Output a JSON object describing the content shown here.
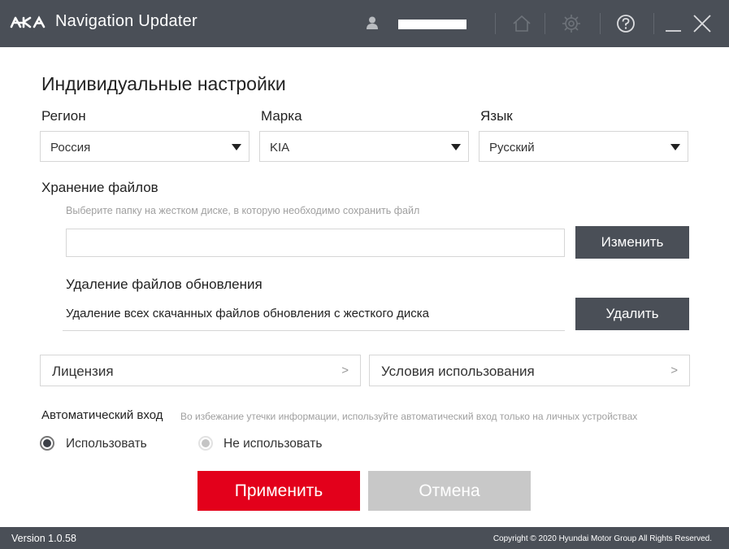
{
  "titlebar": {
    "brand_logo": "KIA",
    "app_title": "Navigation Updater",
    "icons": [
      "user-icon",
      "home-icon",
      "gear-icon",
      "help-icon",
      "minimize-icon",
      "close-icon"
    ]
  },
  "settings": {
    "title": "Индивидуальные настройки",
    "region": {
      "label": "Регион",
      "value": "Россия"
    },
    "brand": {
      "label": "Марка",
      "value": "KIA"
    },
    "language": {
      "label": "Язык",
      "value": "Русский"
    }
  },
  "storage": {
    "title": "Хранение файлов",
    "hint": "Выберите папку на жестком диске, в которую необходимо сохранить файл",
    "path_value": "",
    "change_label": "Изменить"
  },
  "deletion": {
    "title": "Удаление файлов обновления",
    "description": "Удаление всех скачанных файлов обновления с жесткого диска",
    "delete_label": "Удалить"
  },
  "links": {
    "license": "Лицензия",
    "terms": "Условия использования",
    "arrow": ">"
  },
  "auto_login": {
    "label": "Автоматический вход",
    "hint": "Во избежание утечки информации, используйте автоматический вход только на личных устройствах",
    "selected": "use",
    "options": [
      "Использовать",
      "Не использовать"
    ]
  },
  "actions": {
    "apply": "Применить",
    "cancel": "Отмена"
  },
  "footer": {
    "version": "Version 1.0.58",
    "copyright": "Copyright © 2020 Hyundai Motor Group All Rights Reserved."
  },
  "colors": {
    "titlebar_bg": "#4a4f57",
    "accent_red": "#e3001b",
    "cancel_gray": "#c8c8c8"
  }
}
